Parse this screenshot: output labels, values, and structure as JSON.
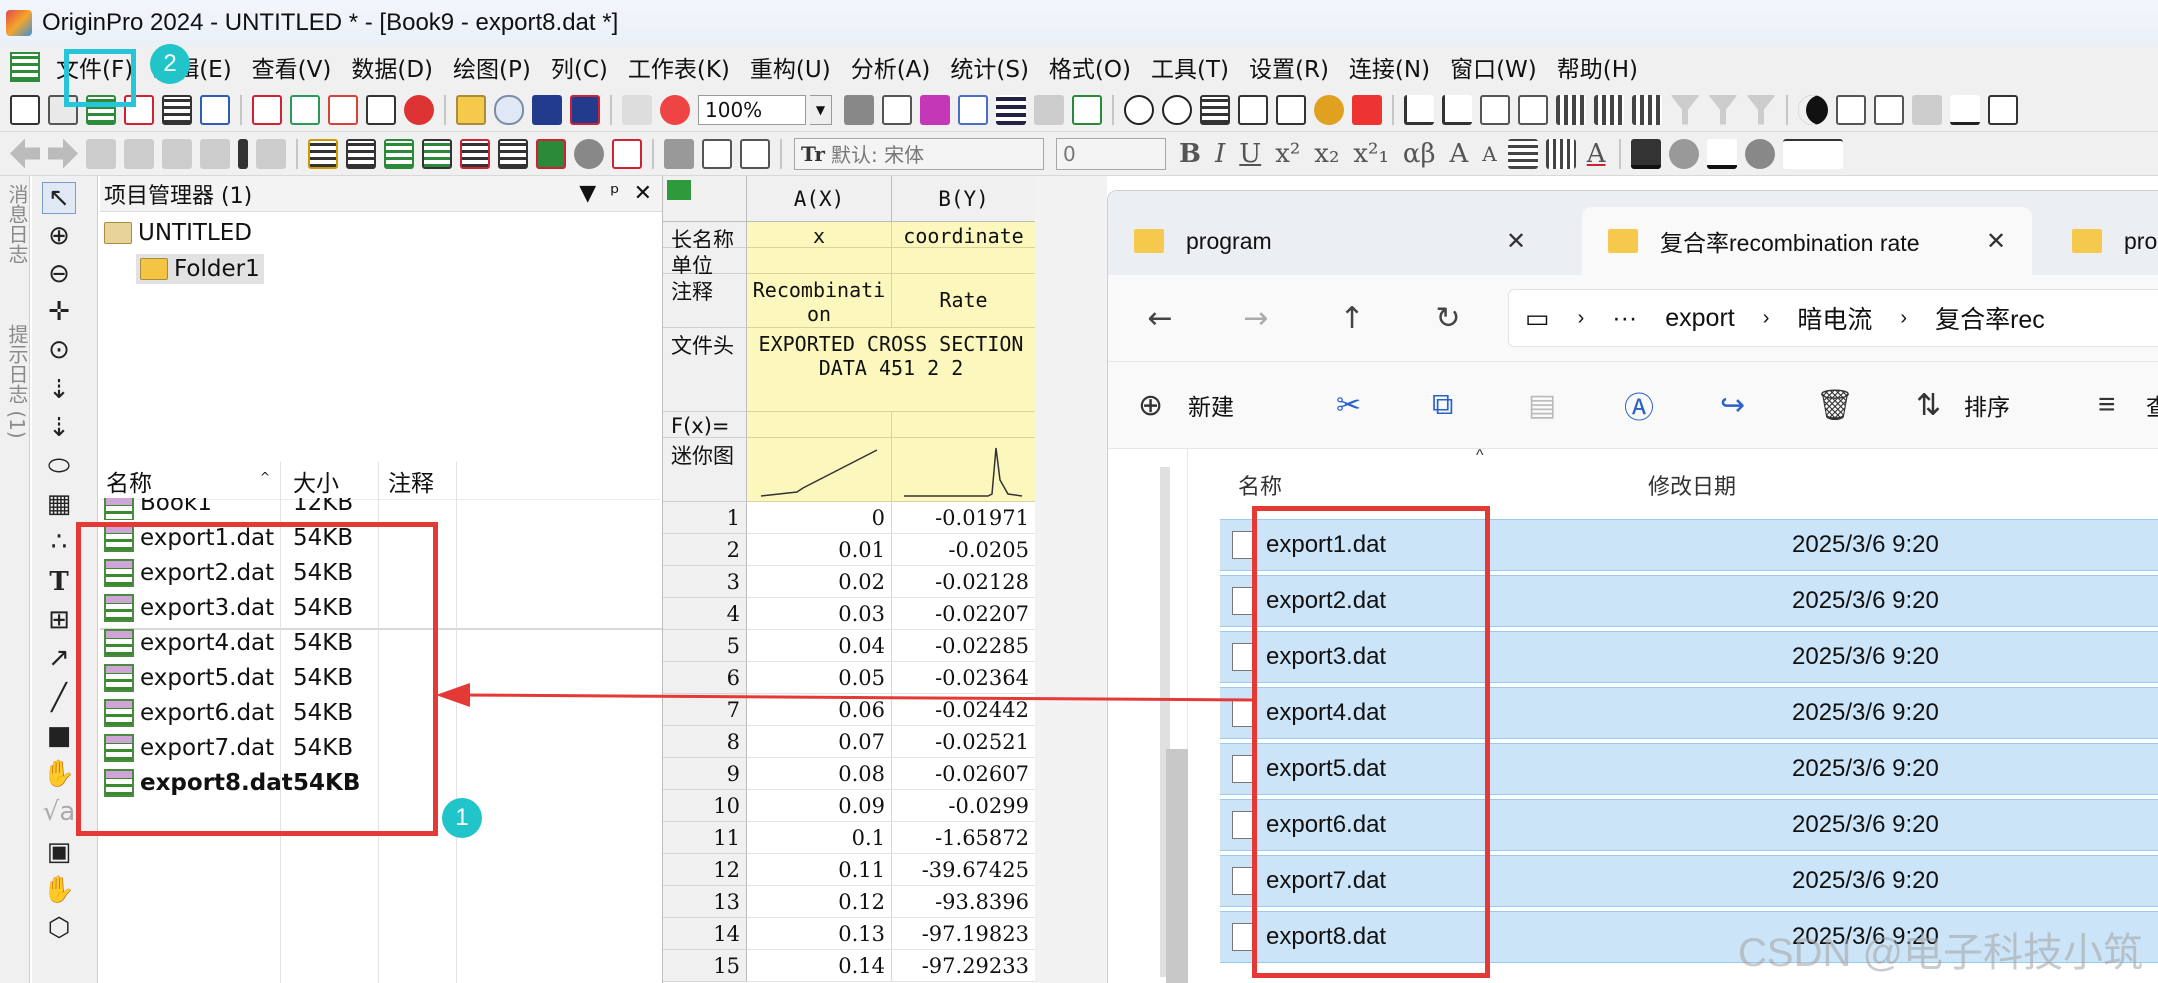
{
  "origin": {
    "title": "OriginPro 2024 - UNTITLED * - [Book9 - export8.dat *]",
    "menus": [
      "文件(F)",
      "编辑(E)",
      "查看(V)",
      "数据(D)",
      "绘图(P)",
      "列(C)",
      "工作表(K)",
      "重构(U)",
      "分析(A)",
      "统计(S)",
      "格式(O)",
      "工具(T)",
      "设置(R)",
      "连接(N)",
      "窗口(W)",
      "帮助(H)"
    ],
    "zoom": "100%",
    "font_name": "默认: 宋体",
    "font_size": "0",
    "side_tabs": [
      "消息日志",
      "提示日志 (1)"
    ],
    "project_explorer": {
      "title": "项目管理器 (1)",
      "root": "UNTITLED",
      "folder": "Folder1",
      "columns": [
        "名称",
        "大小",
        "注释"
      ],
      "items": [
        {
          "name": "Book1",
          "size": "12KB"
        },
        {
          "name": "export1.dat",
          "size": "54KB"
        },
        {
          "name": "export2.dat",
          "size": "54KB"
        },
        {
          "name": "export3.dat",
          "size": "54KB"
        },
        {
          "name": "export4.dat",
          "size": "54KB"
        },
        {
          "name": "export5.dat",
          "size": "54KB"
        },
        {
          "name": "export6.dat",
          "size": "54KB"
        },
        {
          "name": "export7.dat",
          "size": "54KB"
        },
        {
          "name": "export8.dat",
          "size": "54KB"
        }
      ]
    },
    "worksheet": {
      "columns": [
        "A(X)",
        "B(Y)"
      ],
      "labels": [
        "长名称",
        "单位",
        "注释",
        "文件头",
        "F(x)=",
        "迷你图"
      ],
      "long_name": [
        "x",
        "coordinate"
      ],
      "comment": [
        "Recombinati on",
        "Rate"
      ],
      "file_header": "EXPORTED CROSS SECTION DATA 451 2 2",
      "rows": [
        [
          "1",
          "0",
          "-0.01971"
        ],
        [
          "2",
          "0.01",
          "-0.0205"
        ],
        [
          "3",
          "0.02",
          "-0.02128"
        ],
        [
          "4",
          "0.03",
          "-0.02207"
        ],
        [
          "5",
          "0.04",
          "-0.02285"
        ],
        [
          "6",
          "0.05",
          "-0.02364"
        ],
        [
          "7",
          "0.06",
          "-0.02442"
        ],
        [
          "8",
          "0.07",
          "-0.02521"
        ],
        [
          "9",
          "0.08",
          "-0.02607"
        ],
        [
          "10",
          "0.09",
          "-0.0299"
        ],
        [
          "11",
          "0.1",
          "-1.65872"
        ],
        [
          "12",
          "0.11",
          "-39.67425"
        ],
        [
          "13",
          "0.12",
          "-93.8396"
        ],
        [
          "14",
          "0.13",
          "-97.19823"
        ],
        [
          "15",
          "0.14",
          "-97.29233"
        ]
      ]
    }
  },
  "explorer": {
    "tabs": [
      "program",
      "复合率recombination rate",
      "prog"
    ],
    "breadcrumb": [
      "···",
      "export",
      "暗电流",
      "复合率rec"
    ],
    "commands": {
      "new": "新建",
      "sort": "排序",
      "view": "查"
    },
    "columns": {
      "name": "名称",
      "modified": "修改日期"
    },
    "files": [
      {
        "name": "export1.dat",
        "date": "2025/3/6 9:20"
      },
      {
        "name": "export2.dat",
        "date": "2025/3/6 9:20"
      },
      {
        "name": "export3.dat",
        "date": "2025/3/6 9:20"
      },
      {
        "name": "export4.dat",
        "date": "2025/3/6 9:20"
      },
      {
        "name": "export5.dat",
        "date": "2025/3/6 9:20"
      },
      {
        "name": "export6.dat",
        "date": "2025/3/6 9:20"
      },
      {
        "name": "export7.dat",
        "date": "2025/3/6 9:20"
      },
      {
        "name": "export8.dat",
        "date": "2025/3/6 9:20"
      }
    ]
  },
  "annotations": {
    "badge1": "1",
    "badge2": "2",
    "highlight_color": "#e53935",
    "badge_color": "#20c4c9"
  },
  "watermark": "CSDN @电子科技小筑"
}
